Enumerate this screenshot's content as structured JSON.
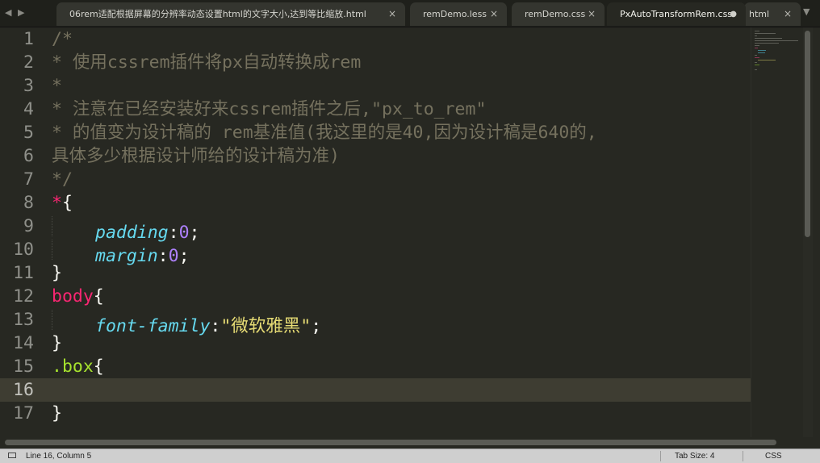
{
  "nav": {
    "left_icon": "◀",
    "right_icon": "▶",
    "more_icon": "▼"
  },
  "tabs": [
    {
      "label": "06rem适配根据屏幕的分辨率动态设置html的文字大小,达到等比缩放.html",
      "close": "×",
      "active": false
    },
    {
      "label": "remDemo.less",
      "close": "×",
      "active": false
    },
    {
      "label": "remDemo.css",
      "close": "×",
      "active": false
    },
    {
      "label": "PxAutoTransformRem.css",
      "close": "●",
      "active": true
    },
    {
      "label": "html",
      "close": "×",
      "active": false
    }
  ],
  "editor": {
    "lines": [
      {
        "n": "1",
        "indent": 0,
        "tokens": [
          {
            "c": "t-comment",
            "t": "/*"
          }
        ]
      },
      {
        "n": "2",
        "indent": 0,
        "tokens": [
          {
            "c": "t-comment",
            "t": "* 使用cssrem插件将px自动转换成rem"
          }
        ]
      },
      {
        "n": "3",
        "indent": 0,
        "tokens": [
          {
            "c": "t-comment",
            "t": "*"
          }
        ]
      },
      {
        "n": "4",
        "indent": 0,
        "tokens": [
          {
            "c": "t-comment",
            "t": "* 注意在已经安装好来cssrem插件之后,\"px_to_rem\""
          }
        ]
      },
      {
        "n": "5",
        "indent": 0,
        "tokens": [
          {
            "c": "t-comment",
            "t": "* 的值变为设计稿的 rem基准值(我这里的是40,因为设计稿是640的,"
          }
        ]
      },
      {
        "n": "6",
        "indent": 0,
        "tokens": [
          {
            "c": "t-comment",
            "t": "具体多少根据设计师给的设计稿为准)"
          }
        ]
      },
      {
        "n": "7",
        "indent": 0,
        "tokens": [
          {
            "c": "t-comment",
            "t": "*/"
          }
        ]
      },
      {
        "n": "8",
        "indent": 0,
        "tokens": [
          {
            "c": "t-sel",
            "t": "*"
          },
          {
            "c": "t-punct",
            "t": "{"
          }
        ]
      },
      {
        "n": "9",
        "indent": 1,
        "tokens": [
          {
            "c": "t-prop",
            "t": "padding"
          },
          {
            "c": "t-punct",
            "t": ":"
          },
          {
            "c": "t-num",
            "t": "0"
          },
          {
            "c": "t-punct",
            "t": ";"
          }
        ]
      },
      {
        "n": "10",
        "indent": 1,
        "tokens": [
          {
            "c": "t-prop",
            "t": "margin"
          },
          {
            "c": "t-punct",
            "t": ":"
          },
          {
            "c": "t-num",
            "t": "0"
          },
          {
            "c": "t-punct",
            "t": ";"
          }
        ]
      },
      {
        "n": "11",
        "indent": 0,
        "tokens": [
          {
            "c": "t-punct",
            "t": "}"
          }
        ]
      },
      {
        "n": "12",
        "indent": 0,
        "tokens": [
          {
            "c": "t-sel",
            "t": "body"
          },
          {
            "c": "t-punct",
            "t": "{"
          }
        ]
      },
      {
        "n": "13",
        "indent": 1,
        "tokens": [
          {
            "c": "t-prop",
            "t": "font-family"
          },
          {
            "c": "t-punct",
            "t": ":"
          },
          {
            "c": "t-str",
            "t": "\"微软雅黑\""
          },
          {
            "c": "t-punct",
            "t": ";"
          }
        ]
      },
      {
        "n": "14",
        "indent": 0,
        "tokens": [
          {
            "c": "t-punct",
            "t": "}"
          }
        ]
      },
      {
        "n": "15",
        "indent": 0,
        "tokens": [
          {
            "c": "t-class",
            "t": ".box"
          },
          {
            "c": "t-punct",
            "t": "{"
          }
        ]
      },
      {
        "n": "16",
        "indent": 0,
        "tokens": [],
        "current": true
      },
      {
        "n": "17",
        "indent": 0,
        "tokens": [
          {
            "c": "t-punct",
            "t": "}"
          }
        ]
      }
    ]
  },
  "status": {
    "position": "Line 16, Column 5",
    "tab_size": "Tab Size: 4",
    "syntax": "CSS"
  },
  "colors": {
    "background": "#272822",
    "comment": "#75715e",
    "selector": "#f92672",
    "property": "#66d9ef",
    "number": "#ae81ff",
    "string": "#e6db74",
    "class": "#a6e22e"
  }
}
